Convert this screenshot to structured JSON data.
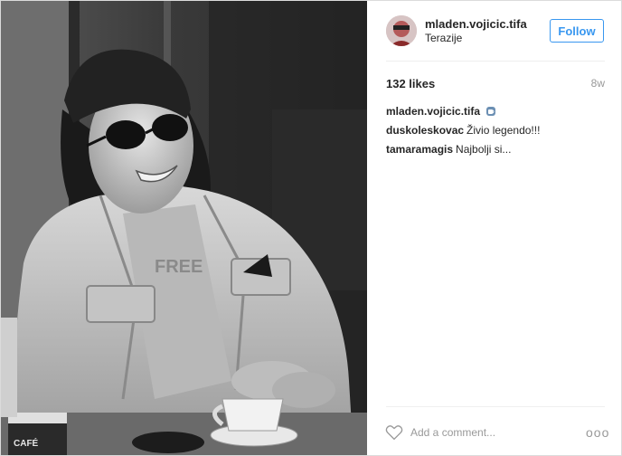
{
  "post": {
    "username": "mladen.vojicic.tifa",
    "location": "Terazije",
    "follow_label": "Follow",
    "likes": "132 likes",
    "time_ago": "8w",
    "caption_user": "mladen.vojicic.tifa",
    "caption_icon": "coffee-cup-emoji-icon",
    "comments": [
      {
        "user": "duskoleskovac",
        "text": "Živio legendo!!!"
      },
      {
        "user": "tamaramagis",
        "text": "Najbolji si..."
      }
    ],
    "add_comment_placeholder": "Add a comment...",
    "more_label": "ooo",
    "accent_color": "#3897f0"
  },
  "photo": {
    "shirt_text": "FREE",
    "cup_brand": "CAFÉ"
  }
}
